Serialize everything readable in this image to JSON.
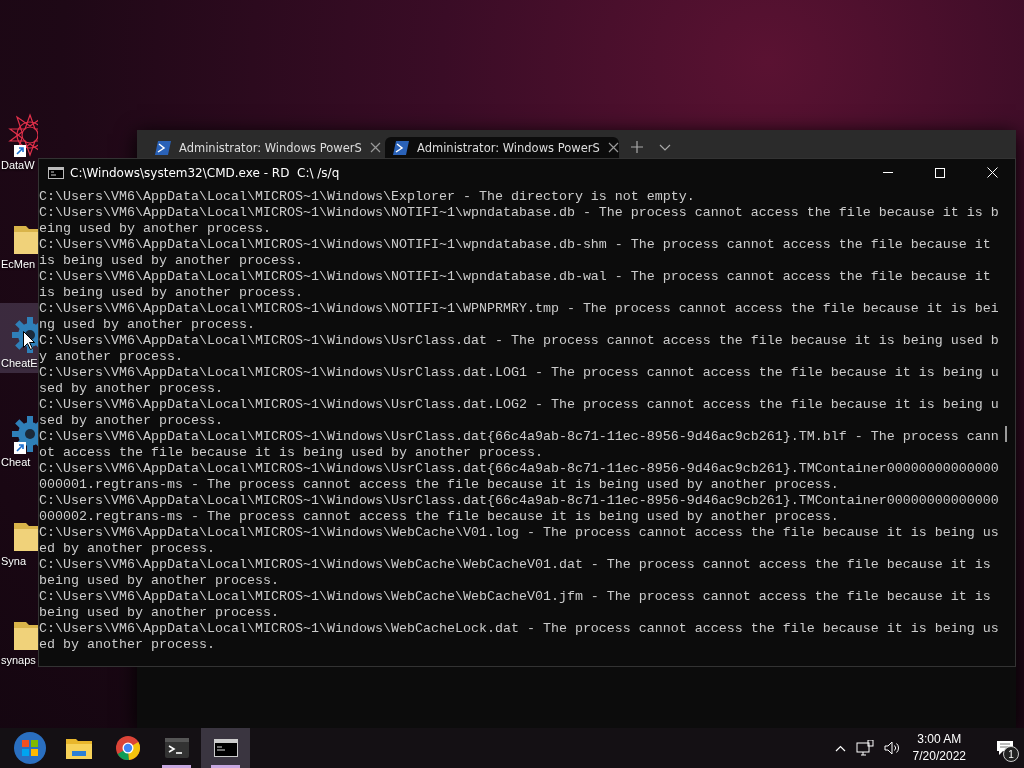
{
  "desktop_icons": [
    {
      "label": "DataW",
      "kind": "star-art",
      "shortcut": true,
      "selected": false
    },
    {
      "label": "EcMen",
      "kind": "folder",
      "shortcut": false,
      "selected": false
    },
    {
      "label": "CheatE",
      "kind": "gear",
      "shortcut": false,
      "selected": true
    },
    {
      "label": "Cheat",
      "kind": "gear",
      "shortcut": true,
      "selected": false
    },
    {
      "label": "Syna",
      "kind": "folder",
      "shortcut": false,
      "selected": false
    },
    {
      "label": "synaps",
      "kind": "folder",
      "shortcut": false,
      "selected": false
    }
  ],
  "terminal_window": {
    "tabs": [
      {
        "title": "Administrator: Windows PowerS",
        "selected": false
      },
      {
        "title": "Administrator: Windows PowerS",
        "selected": true
      }
    ]
  },
  "cmd_window": {
    "title": "C:\\Windows\\system32\\CMD.exe - RD  C:\\ /s/q",
    "lines": [
      "C:\\Users\\VM6\\AppData\\Local\\MICROS~1\\Windows\\Explorer - The directory is not empty.",
      "C:\\Users\\VM6\\AppData\\Local\\MICROS~1\\Windows\\NOTIFI~1\\wpndatabase.db - The process cannot access the file because it is b",
      "eing used by another process.",
      "C:\\Users\\VM6\\AppData\\Local\\MICROS~1\\Windows\\NOTIFI~1\\wpndatabase.db-shm - The process cannot access the file because it",
      "is being used by another process.",
      "C:\\Users\\VM6\\AppData\\Local\\MICROS~1\\Windows\\NOTIFI~1\\wpndatabase.db-wal - The process cannot access the file because it",
      "is being used by another process.",
      "C:\\Users\\VM6\\AppData\\Local\\MICROS~1\\Windows\\NOTIFI~1\\WPNPRMRY.tmp - The process cannot access the file because it is bei",
      "ng used by another process.",
      "C:\\Users\\VM6\\AppData\\Local\\MICROS~1\\Windows\\UsrClass.dat - The process cannot access the file because it is being used b",
      "y another process.",
      "C:\\Users\\VM6\\AppData\\Local\\MICROS~1\\Windows\\UsrClass.dat.LOG1 - The process cannot access the file because it is being u",
      "sed by another process.",
      "C:\\Users\\VM6\\AppData\\Local\\MICROS~1\\Windows\\UsrClass.dat.LOG2 - The process cannot access the file because it is being u",
      "sed by another process.",
      "C:\\Users\\VM6\\AppData\\Local\\MICROS~1\\Windows\\UsrClass.dat{66c4a9ab-8c71-11ec-8956-9d46ac9cb261}.TM.blf - The process cann",
      "ot access the file because it is being used by another process.",
      "C:\\Users\\VM6\\AppData\\Local\\MICROS~1\\Windows\\UsrClass.dat{66c4a9ab-8c71-11ec-8956-9d46ac9cb261}.TMContainer00000000000000",
      "000001.regtrans-ms - The process cannot access the file because it is being used by another process.",
      "C:\\Users\\VM6\\AppData\\Local\\MICROS~1\\Windows\\UsrClass.dat{66c4a9ab-8c71-11ec-8956-9d46ac9cb261}.TMContainer00000000000000",
      "000002.regtrans-ms - The process cannot access the file because it is being used by another process.",
      "C:\\Users\\VM6\\AppData\\Local\\MICROS~1\\Windows\\WebCache\\V01.log - The process cannot access the file because it is being us",
      "ed by another process.",
      "C:\\Users\\VM6\\AppData\\Local\\MICROS~1\\Windows\\WebCache\\WebCacheV01.dat - The process cannot access the file because it is",
      "being used by another process.",
      "C:\\Users\\VM6\\AppData\\Local\\MICROS~1\\Windows\\WebCache\\WebCacheV01.jfm - The process cannot access the file because it is",
      "being used by another process.",
      "C:\\Users\\VM6\\AppData\\Local\\MICROS~1\\Windows\\WebCacheLock.dat - The process cannot access the file because it is being us",
      "ed by another process."
    ]
  },
  "taskbar": {
    "apps": [
      {
        "kind": "start",
        "selected": false,
        "running": false
      },
      {
        "kind": "folder",
        "selected": false,
        "running": false
      },
      {
        "kind": "browser",
        "selected": false,
        "running": false
      },
      {
        "kind": "terminal",
        "selected": false,
        "running": true
      },
      {
        "kind": "cmd",
        "selected": true,
        "running": true
      }
    ],
    "time": "3:00 AM",
    "date": "7/20/2022",
    "notification_count": "1"
  }
}
